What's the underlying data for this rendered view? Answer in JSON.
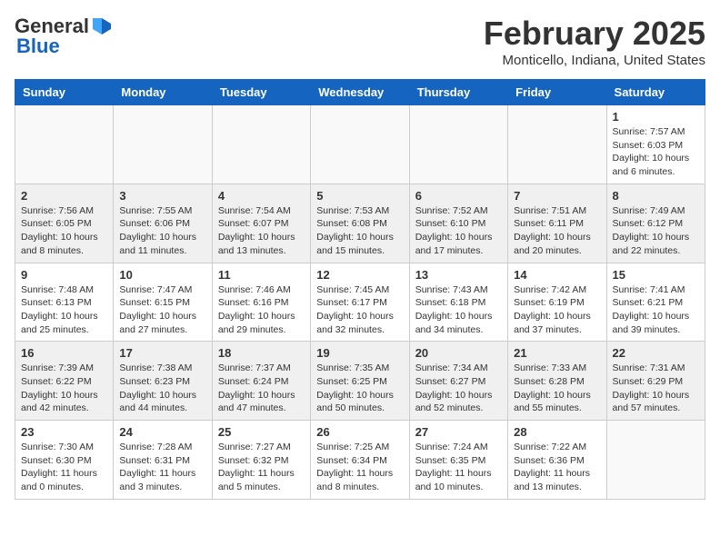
{
  "header": {
    "logo_general": "General",
    "logo_blue": "Blue",
    "month_title": "February 2025",
    "location": "Monticello, Indiana, United States"
  },
  "weekdays": [
    "Sunday",
    "Monday",
    "Tuesday",
    "Wednesday",
    "Thursday",
    "Friday",
    "Saturday"
  ],
  "weeks": [
    {
      "row_class": "row-white",
      "days": [
        {
          "num": "",
          "info": "",
          "empty": true
        },
        {
          "num": "",
          "info": "",
          "empty": true
        },
        {
          "num": "",
          "info": "",
          "empty": true
        },
        {
          "num": "",
          "info": "",
          "empty": true
        },
        {
          "num": "",
          "info": "",
          "empty": true
        },
        {
          "num": "",
          "info": "",
          "empty": true
        },
        {
          "num": "1",
          "info": "Sunrise: 7:57 AM\nSunset: 6:03 PM\nDaylight: 10 hours\nand 6 minutes.",
          "empty": false
        }
      ]
    },
    {
      "row_class": "row-alt",
      "days": [
        {
          "num": "2",
          "info": "Sunrise: 7:56 AM\nSunset: 6:05 PM\nDaylight: 10 hours\nand 8 minutes.",
          "empty": false
        },
        {
          "num": "3",
          "info": "Sunrise: 7:55 AM\nSunset: 6:06 PM\nDaylight: 10 hours\nand 11 minutes.",
          "empty": false
        },
        {
          "num": "4",
          "info": "Sunrise: 7:54 AM\nSunset: 6:07 PM\nDaylight: 10 hours\nand 13 minutes.",
          "empty": false
        },
        {
          "num": "5",
          "info": "Sunrise: 7:53 AM\nSunset: 6:08 PM\nDaylight: 10 hours\nand 15 minutes.",
          "empty": false
        },
        {
          "num": "6",
          "info": "Sunrise: 7:52 AM\nSunset: 6:10 PM\nDaylight: 10 hours\nand 17 minutes.",
          "empty": false
        },
        {
          "num": "7",
          "info": "Sunrise: 7:51 AM\nSunset: 6:11 PM\nDaylight: 10 hours\nand 20 minutes.",
          "empty": false
        },
        {
          "num": "8",
          "info": "Sunrise: 7:49 AM\nSunset: 6:12 PM\nDaylight: 10 hours\nand 22 minutes.",
          "empty": false
        }
      ]
    },
    {
      "row_class": "row-white",
      "days": [
        {
          "num": "9",
          "info": "Sunrise: 7:48 AM\nSunset: 6:13 PM\nDaylight: 10 hours\nand 25 minutes.",
          "empty": false
        },
        {
          "num": "10",
          "info": "Sunrise: 7:47 AM\nSunset: 6:15 PM\nDaylight: 10 hours\nand 27 minutes.",
          "empty": false
        },
        {
          "num": "11",
          "info": "Sunrise: 7:46 AM\nSunset: 6:16 PM\nDaylight: 10 hours\nand 29 minutes.",
          "empty": false
        },
        {
          "num": "12",
          "info": "Sunrise: 7:45 AM\nSunset: 6:17 PM\nDaylight: 10 hours\nand 32 minutes.",
          "empty": false
        },
        {
          "num": "13",
          "info": "Sunrise: 7:43 AM\nSunset: 6:18 PM\nDaylight: 10 hours\nand 34 minutes.",
          "empty": false
        },
        {
          "num": "14",
          "info": "Sunrise: 7:42 AM\nSunset: 6:19 PM\nDaylight: 10 hours\nand 37 minutes.",
          "empty": false
        },
        {
          "num": "15",
          "info": "Sunrise: 7:41 AM\nSunset: 6:21 PM\nDaylight: 10 hours\nand 39 minutes.",
          "empty": false
        }
      ]
    },
    {
      "row_class": "row-alt",
      "days": [
        {
          "num": "16",
          "info": "Sunrise: 7:39 AM\nSunset: 6:22 PM\nDaylight: 10 hours\nand 42 minutes.",
          "empty": false
        },
        {
          "num": "17",
          "info": "Sunrise: 7:38 AM\nSunset: 6:23 PM\nDaylight: 10 hours\nand 44 minutes.",
          "empty": false
        },
        {
          "num": "18",
          "info": "Sunrise: 7:37 AM\nSunset: 6:24 PM\nDaylight: 10 hours\nand 47 minutes.",
          "empty": false
        },
        {
          "num": "19",
          "info": "Sunrise: 7:35 AM\nSunset: 6:25 PM\nDaylight: 10 hours\nand 50 minutes.",
          "empty": false
        },
        {
          "num": "20",
          "info": "Sunrise: 7:34 AM\nSunset: 6:27 PM\nDaylight: 10 hours\nand 52 minutes.",
          "empty": false
        },
        {
          "num": "21",
          "info": "Sunrise: 7:33 AM\nSunset: 6:28 PM\nDaylight: 10 hours\nand 55 minutes.",
          "empty": false
        },
        {
          "num": "22",
          "info": "Sunrise: 7:31 AM\nSunset: 6:29 PM\nDaylight: 10 hours\nand 57 minutes.",
          "empty": false
        }
      ]
    },
    {
      "row_class": "row-white",
      "days": [
        {
          "num": "23",
          "info": "Sunrise: 7:30 AM\nSunset: 6:30 PM\nDaylight: 11 hours\nand 0 minutes.",
          "empty": false
        },
        {
          "num": "24",
          "info": "Sunrise: 7:28 AM\nSunset: 6:31 PM\nDaylight: 11 hours\nand 3 minutes.",
          "empty": false
        },
        {
          "num": "25",
          "info": "Sunrise: 7:27 AM\nSunset: 6:32 PM\nDaylight: 11 hours\nand 5 minutes.",
          "empty": false
        },
        {
          "num": "26",
          "info": "Sunrise: 7:25 AM\nSunset: 6:34 PM\nDaylight: 11 hours\nand 8 minutes.",
          "empty": false
        },
        {
          "num": "27",
          "info": "Sunrise: 7:24 AM\nSunset: 6:35 PM\nDaylight: 11 hours\nand 10 minutes.",
          "empty": false
        },
        {
          "num": "28",
          "info": "Sunrise: 7:22 AM\nSunset: 6:36 PM\nDaylight: 11 hours\nand 13 minutes.",
          "empty": false
        },
        {
          "num": "",
          "info": "",
          "empty": true
        }
      ]
    }
  ]
}
